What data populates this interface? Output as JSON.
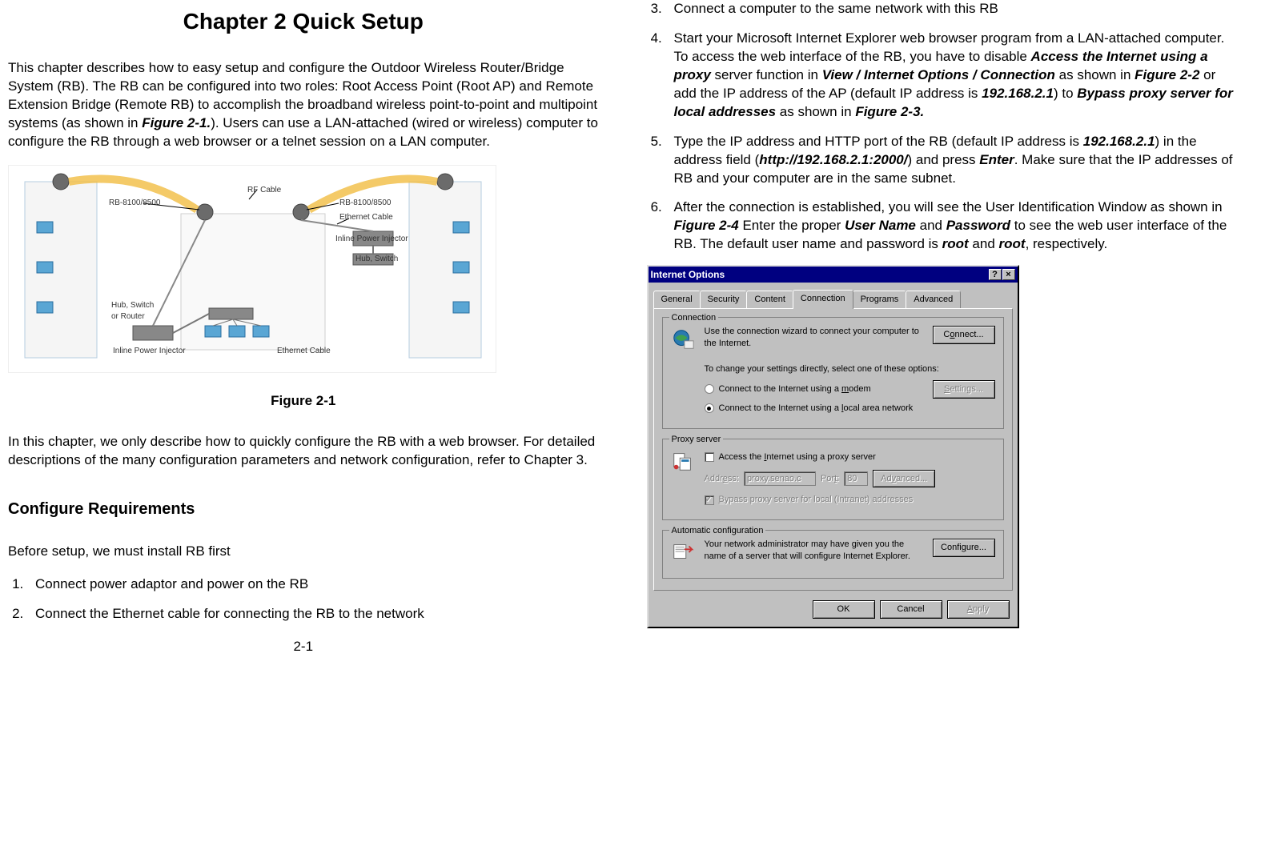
{
  "left": {
    "chapter_title": "Chapter 2    Quick Setup",
    "intro": "This chapter describes how to easy setup and configure the Outdoor Wireless Router/Bridge System (RB). The RB can be configured into two roles: Root Access Point (Root AP) and Remote Extension Bridge (Remote RB) to accomplish the broadband wireless point-to-point and multipoint systems (as shown in Figure 2-1.). Users can use a LAN-attached (wired or wireless) computer to configure the RB through a web browser or a telnet session on a LAN computer.",
    "diagram_labels": {
      "rb_left": "RB-8100/8500",
      "rb_right": "RB-8100/8500",
      "rf_cable": "RF Cable",
      "ethernet_cable_top": "Ethernet Cable",
      "inline_power_top": "Inline Power Injector",
      "hub_switch_top": "Hub, Switch",
      "hub_switch_bottom": "Hub, Switch\nor Router",
      "inline_power_bottom": "Inline Power Injector",
      "ethernet_cable_bottom": "Ethernet Cable"
    },
    "figure_caption": "Figure 2-1",
    "midtext": "In this chapter, we only describe how to quickly configure the RB with a web browser. For detailed descriptions of the many configuration parameters and network configuration, refer to Chapter 3.",
    "requirements_heading": "Configure Requirements",
    "before_setup": "Before setup, we must install RB first",
    "steps12": [
      "Connect power adaptor and power on the RB",
      "Connect the Ethernet cable for connecting the RB to the network"
    ],
    "page_num": "2-1"
  },
  "right": {
    "steps3456": [
      {
        "plain": "Connect a computer to the same network with this RB"
      },
      {
        "html": "Start your Microsoft Internet Explorer web browser program from a LAN-attached computer. To access the web interface of the RB, you have to disable <b><i>Access the Internet using a proxy</i></b> server function in <b><i>View / Internet Options / Connection</i></b> as shown in <b><i>Figure 2-2</i></b> or add the IP address of the AP (default IP address is <b><i>192.168.2.1</i></b>) to <b><i>Bypass proxy server for local addresses</i></b> as shown in <b><i>Figure 2-3.</i></b>"
      },
      {
        "html": "Type the IP address and HTTP port of the RB (default IP address is <b><i>192.168.2.1</i></b>) in the address field (<b><i>http://192.168.2.1:2000/</i></b>) and press <b><i>Enter</i></b>. Make sure that the IP addresses of RB and your computer are in the same subnet."
      },
      {
        "html": "After the connection is established, you will see the User Identification Window as shown in <b><i>Figure 2-4</i></b> Enter the proper <b><i>User Name</i></b> and <b><i>Password</i></b> to see the web user interface of the RB. The default user name and password is <b><i>root</i></b> and <b><i>root</i></b>, respectively."
      }
    ],
    "dialog": {
      "title": "Internet Options",
      "titlebar_help": "?",
      "titlebar_close": "×",
      "tabs": [
        "General",
        "Security",
        "Content",
        "Connection",
        "Programs",
        "Advanced"
      ],
      "active_tab": "Connection",
      "group_connection": {
        "legend": "Connection",
        "wizard_text": "Use the connection wizard to connect your computer to the Internet.",
        "connect_btn": "Connect...",
        "change_text": "To change your settings directly, select one of these options:",
        "radio_modem": "Connect to the Internet using a modem",
        "settings_btn": "Settings...",
        "radio_lan": "Connect to the Internet using a local area network"
      },
      "group_proxy": {
        "legend": "Proxy server",
        "access_check": "Access the Internet using a proxy server",
        "address_label": "Address:",
        "address_value": "proxy.senao.c",
        "port_label": "Port:",
        "port_value": "80",
        "advanced_btn": "Advanced...",
        "bypass_check": "Bypass proxy server for local (Intranet) addresses"
      },
      "group_auto": {
        "legend": "Automatic configuration",
        "auto_text": "Your network administrator may have given you the name of a server that will configure Internet Explorer.",
        "configure_btn": "Configure..."
      },
      "footer": {
        "ok": "OK",
        "cancel": "Cancel",
        "apply": "Apply"
      }
    }
  }
}
